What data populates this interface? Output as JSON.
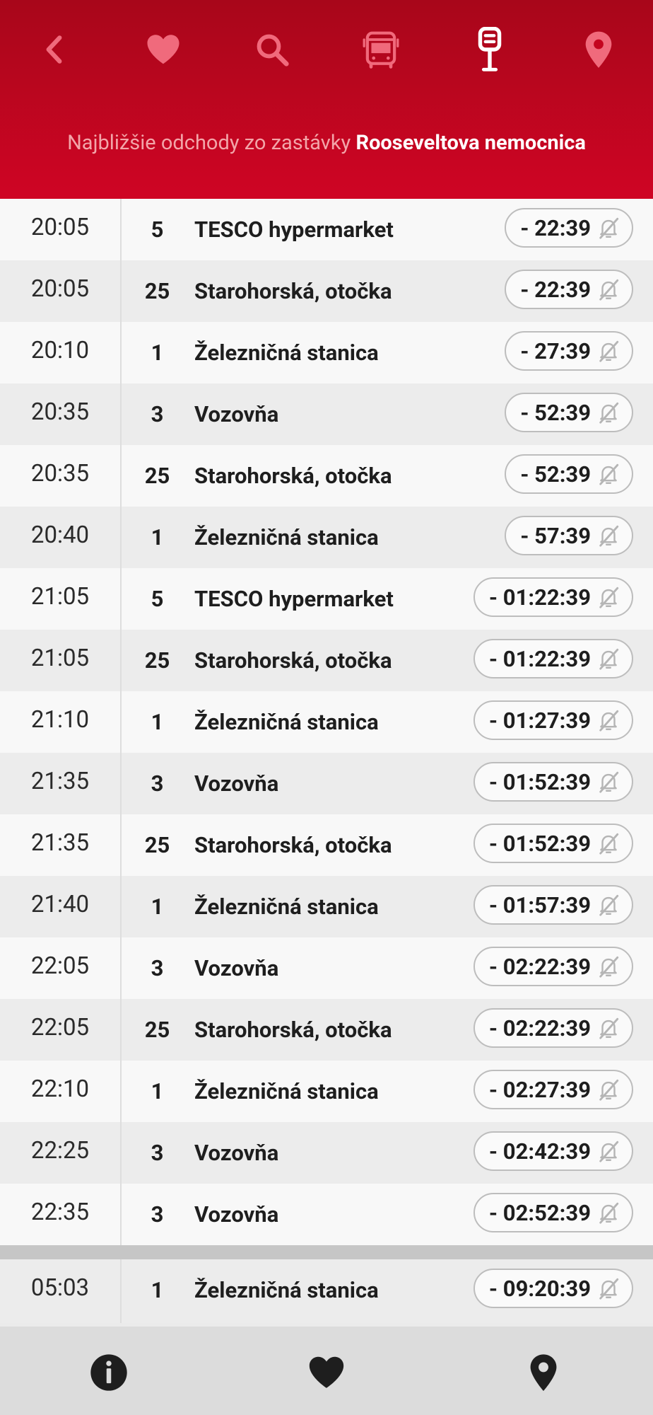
{
  "header": {
    "subtitle_prefix": "Najbližšie odchody zo zastávky",
    "stop_name": "Rooseveltova nemocnica",
    "nav": [
      "back-icon",
      "heart-icon",
      "search-icon",
      "bus-icon",
      "stop-sign-icon",
      "location-pin-icon"
    ]
  },
  "departures": [
    {
      "time": "20:05",
      "line": "5",
      "dest": "TESCO hypermarket",
      "remaining": "- 22:39"
    },
    {
      "time": "20:05",
      "line": "25",
      "dest": "Starohorská, otočka",
      "remaining": "- 22:39"
    },
    {
      "time": "20:10",
      "line": "1",
      "dest": "Železničná stanica",
      "remaining": "- 27:39"
    },
    {
      "time": "20:35",
      "line": "3",
      "dest": "Vozovňa",
      "remaining": "- 52:39"
    },
    {
      "time": "20:35",
      "line": "25",
      "dest": "Starohorská, otočka",
      "remaining": "- 52:39"
    },
    {
      "time": "20:40",
      "line": "1",
      "dest": "Železničná stanica",
      "remaining": "- 57:39"
    },
    {
      "time": "21:05",
      "line": "5",
      "dest": "TESCO hypermarket",
      "remaining": "- 01:22:39"
    },
    {
      "time": "21:05",
      "line": "25",
      "dest": "Starohorská, otočka",
      "remaining": "- 01:22:39"
    },
    {
      "time": "21:10",
      "line": "1",
      "dest": "Železničná stanica",
      "remaining": "- 01:27:39"
    },
    {
      "time": "21:35",
      "line": "3",
      "dest": "Vozovňa",
      "remaining": "- 01:52:39"
    },
    {
      "time": "21:35",
      "line": "25",
      "dest": "Starohorská, otočka",
      "remaining": "- 01:52:39"
    },
    {
      "time": "21:40",
      "line": "1",
      "dest": "Železničná stanica",
      "remaining": "- 01:57:39"
    },
    {
      "time": "22:05",
      "line": "3",
      "dest": "Vozovňa",
      "remaining": "- 02:22:39"
    },
    {
      "time": "22:05",
      "line": "25",
      "dest": "Starohorská, otočka",
      "remaining": "- 02:22:39"
    },
    {
      "time": "22:10",
      "line": "1",
      "dest": "Železničná stanica",
      "remaining": "- 02:27:39"
    },
    {
      "time": "22:25",
      "line": "3",
      "dest": "Vozovňa",
      "remaining": "- 02:42:39"
    },
    {
      "time": "22:35",
      "line": "3",
      "dest": "Vozovňa",
      "remaining": "- 02:52:39"
    }
  ],
  "next_day": [
    {
      "time": "05:03",
      "line": "1",
      "dest": "Železničná stanica",
      "remaining": "- 09:20:39"
    }
  ],
  "bottom_nav": [
    "info-icon",
    "heart-icon",
    "location-pin-icon"
  ],
  "colors": {
    "header_top": "#a8061a",
    "header_bottom": "#cf0524",
    "icon_inactive": "#f06a7c",
    "icon_active": "#ffffff"
  }
}
